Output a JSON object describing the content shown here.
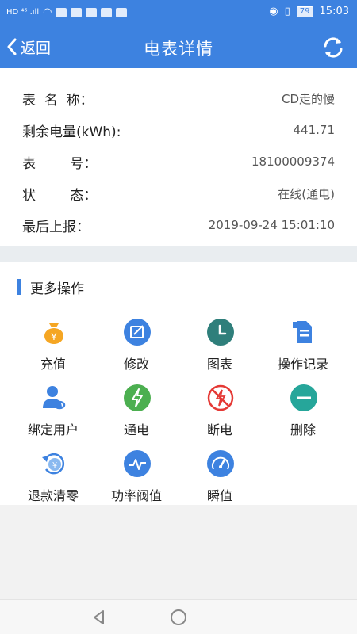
{
  "status_bar": {
    "time": "15:03",
    "battery": "79"
  },
  "nav": {
    "back_label": "返回",
    "title": "电表详情"
  },
  "info": {
    "rows": [
      {
        "label": "表  名  称：",
        "value": "CD走的慢"
      },
      {
        "label": "剩余电量(kWh):",
        "value": "441.71"
      },
      {
        "label": "表        号：",
        "value": "18100009374"
      },
      {
        "label": "状        态：",
        "value": "在线(通电)"
      },
      {
        "label": "最后上报：",
        "value": "2019-09-24 15:01:10"
      }
    ]
  },
  "ops": {
    "title": "更多操作",
    "items": [
      {
        "label": "充值",
        "icon": "money-bag-icon",
        "color": "#f5a623"
      },
      {
        "label": "修改",
        "icon": "edit-icon",
        "color": "#3d82e0"
      },
      {
        "label": "图表",
        "icon": "clock-chart-icon",
        "color": "#2f7f7b"
      },
      {
        "label": "操作记录",
        "icon": "document-icon",
        "color": "#3d82e0"
      },
      {
        "label": "绑定用户",
        "icon": "user-link-icon",
        "color": "#3d82e0"
      },
      {
        "label": "通电",
        "icon": "power-on-icon",
        "color": "#4caf50"
      },
      {
        "label": "断电",
        "icon": "power-off-icon",
        "color": "#e53935"
      },
      {
        "label": "删除",
        "icon": "minus-icon",
        "color": "#26a69a"
      },
      {
        "label": "退款清零",
        "icon": "refund-icon",
        "color": "#3d82e0"
      },
      {
        "label": "功率阀值",
        "icon": "pulse-icon",
        "color": "#3d82e0"
      },
      {
        "label": "瞬值",
        "icon": "gauge-icon",
        "color": "#3d82e0"
      }
    ]
  }
}
